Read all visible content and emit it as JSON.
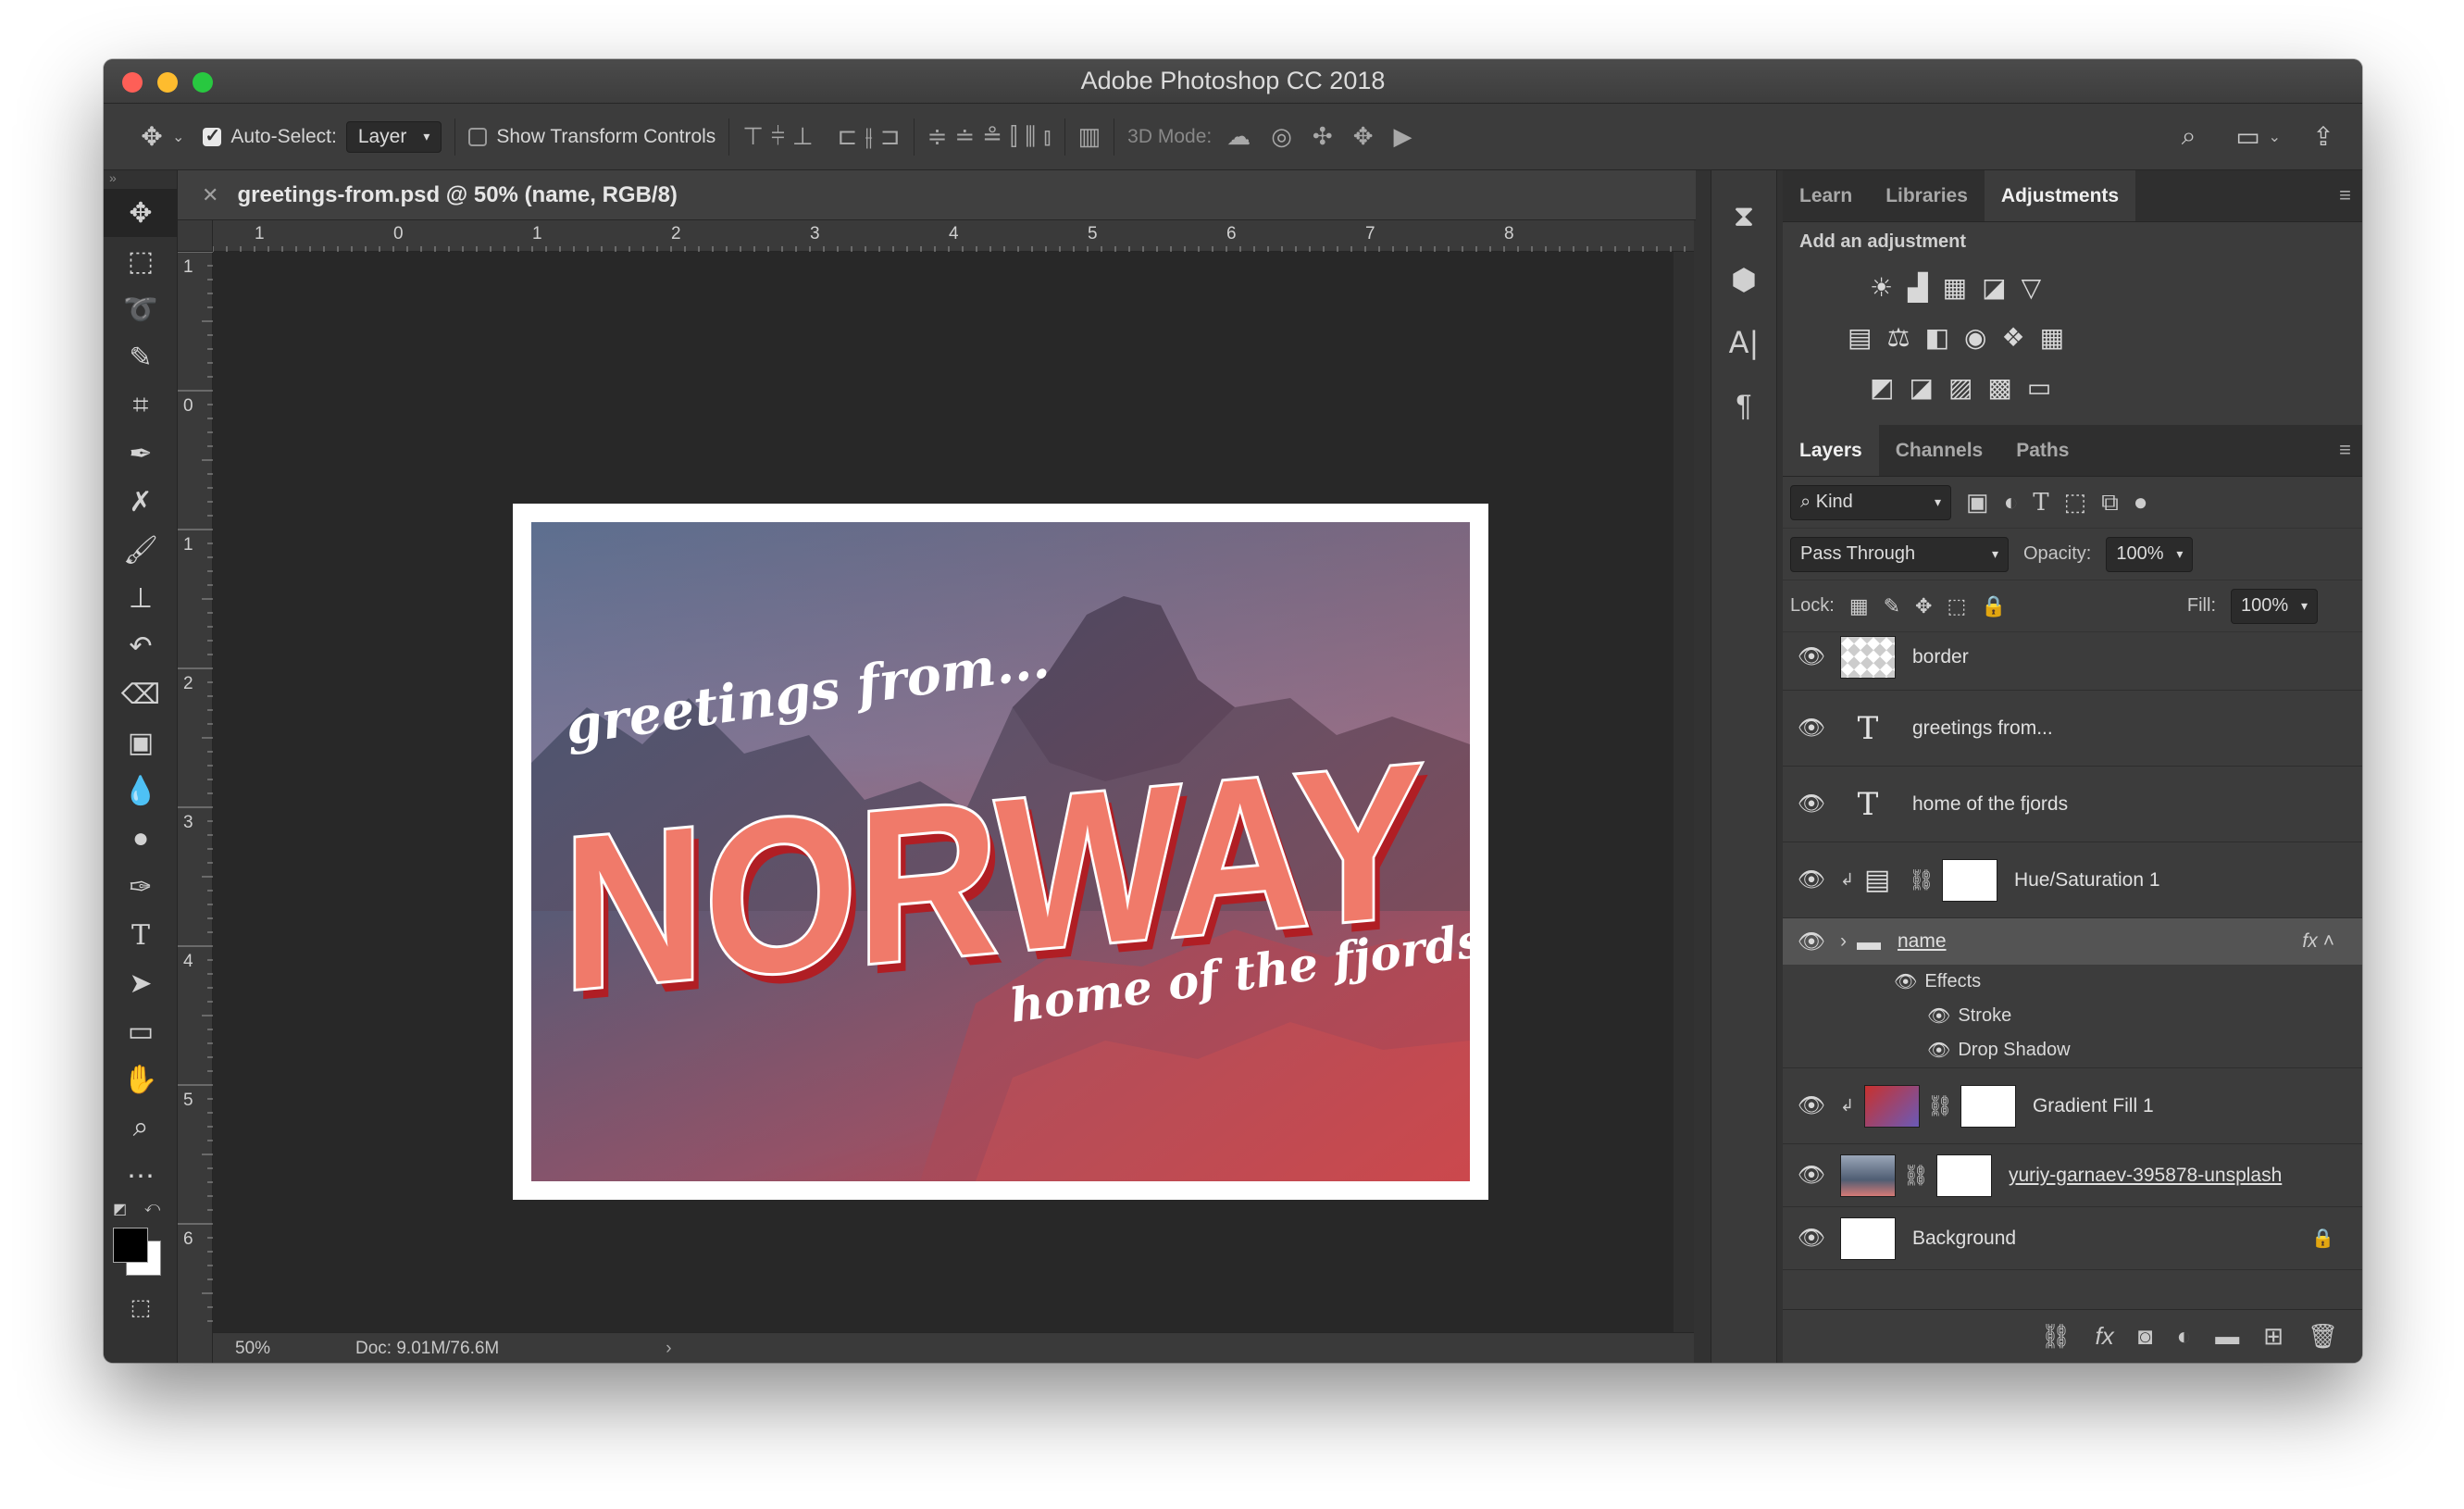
{
  "app": {
    "title": "Adobe Photoshop CC 2018"
  },
  "options_bar": {
    "auto_select_label": "Auto-Select:",
    "auto_select_value": "Layer",
    "show_transform_label": "Show Transform Controls",
    "mode_3d_label": "3D Mode:"
  },
  "document": {
    "tab_title": "greetings-from.psd @ 50% (name, RGB/8)",
    "zoom": "50%",
    "doc_size": "Doc: 9.01M/76.6M"
  },
  "rulers": {
    "h_labels": [
      "1",
      "0",
      "1",
      "2",
      "3",
      "4",
      "5",
      "6",
      "7",
      "8"
    ],
    "v_labels": [
      "1",
      "0",
      "1",
      "2",
      "3",
      "4",
      "5",
      "6"
    ]
  },
  "artwork": {
    "greetings": "greetings from...",
    "norway": "NORWAY",
    "fjords": "home of the fjords"
  },
  "panels": {
    "top_tabs": [
      "Learn",
      "Libraries",
      "Adjustments"
    ],
    "active_top_tab": "Adjustments",
    "adjustments_title": "Add an adjustment",
    "layer_tabs": [
      "Layers",
      "Channels",
      "Paths"
    ],
    "filter_kind": "Kind",
    "blend_mode": "Pass Through",
    "opacity_label": "Opacity:",
    "opacity_value": "100%",
    "lock_label": "Lock:",
    "fill_label": "Fill:",
    "fill_value": "100%"
  },
  "layers": [
    {
      "name": "border",
      "kind": "pixel-empty"
    },
    {
      "name": "greetings from...",
      "kind": "text"
    },
    {
      "name": "home of the fjords",
      "kind": "text"
    },
    {
      "name": "Hue/Saturation 1",
      "kind": "adjustment"
    },
    {
      "name": "name",
      "kind": "group",
      "selected": true,
      "effects_label": "Effects",
      "effects": [
        "Stroke",
        "Drop Shadow"
      ]
    },
    {
      "name": "Gradient Fill 1",
      "kind": "fill"
    },
    {
      "name": "yuriy-garnaev-395878-unsplash",
      "kind": "smart"
    },
    {
      "name": "Background",
      "kind": "background"
    }
  ],
  "colors": {
    "accent_red": "#e8423b",
    "panel_bg": "#3c3c3c",
    "canvas_bg": "#282828"
  }
}
